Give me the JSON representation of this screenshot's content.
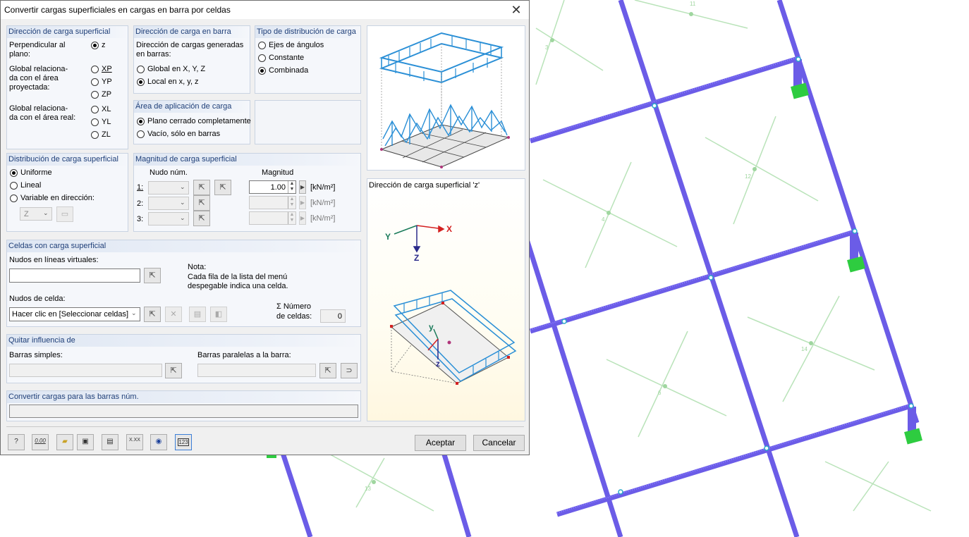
{
  "dialog": {
    "title": "Convertir cargas superficiales en cargas en barra por celdas",
    "close_icon": "close-icon"
  },
  "surface_load_direction": {
    "header": "Dirección de carga superficial",
    "perpendicular_label": "Perpendicular al plano:",
    "perpendicular_option": "z",
    "global_projected_label": "Global relaciona-da con el área proyectada:",
    "global_projected_options": [
      "XP",
      "YP",
      "ZP"
    ],
    "global_real_label": "Global relaciona-da con el área real:",
    "global_real_options": [
      "XL",
      "YL",
      "ZL"
    ],
    "selected": "z"
  },
  "member_load_direction": {
    "header": "Dirección de carga en barra",
    "description": "Dirección de cargas generadas en barras:",
    "options": [
      "Global en X, Y, Z",
      "Local en x, y, z"
    ],
    "selected": "Local en x, y, z"
  },
  "distribution_type": {
    "header": "Tipo de distribución de carga",
    "options": [
      "Ejes de ángulos",
      "Constante",
      "Combinada"
    ],
    "selected": "Combinada"
  },
  "load_application_area": {
    "header": "Área de aplicación de carga",
    "options": [
      "Plano cerrado completamente",
      "Vacío, sólo en barras"
    ],
    "selected": "Plano cerrado completamente"
  },
  "surface_load_distribution": {
    "header": "Distribución de carga superficial",
    "options": [
      "Uniforme",
      "Lineal",
      "Variable en dirección:"
    ],
    "selected": "Uniforme",
    "direction_value": "Z"
  },
  "surface_load_magnitude": {
    "header": "Magnitud de carga superficial",
    "node_col": "Nudo núm.",
    "magnitude_col": "Magnitud",
    "rows": [
      {
        "label": "1:",
        "value": "1.00",
        "unit": "[kN/m²]"
      },
      {
        "label": "2:",
        "value": "",
        "unit": "[kN/m²]"
      },
      {
        "label": "3:",
        "value": "",
        "unit": "[kN/m²]"
      }
    ]
  },
  "cells": {
    "header": "Celdas con carga superficial",
    "virtual_nodes_label": "Nudos en líneas virtuales:",
    "virtual_nodes_value": "",
    "note_title": "Nota:",
    "note_text_1": "Cada fila de la lista del menú",
    "note_text_2": "despegable indica una celda.",
    "cell_nodes_label": "Nudos de celda:",
    "cell_nodes_value": "Hacer clic en [Seleccionar celdas]",
    "count_label_1": "Σ Número",
    "count_label_2": "de celdas:",
    "count_value": "0"
  },
  "remove_influence": {
    "header": "Quitar influencia de",
    "simple_members_label": "Barras simples:",
    "parallel_members_label": "Barras paralelas a la barra:"
  },
  "convert_for_members": {
    "header": "Convertir cargas para las barras núm.",
    "value": ""
  },
  "info_panel": {
    "title": "Dirección de carga superficial 'z'",
    "axis_x": "X",
    "axis_y": "Y",
    "axis_z": "Z",
    "local_y": "y",
    "local_z": "z"
  },
  "footer": {
    "ok_label": "Aceptar",
    "cancel_label": "Cancelar",
    "tool_icons": [
      "help-icon",
      "decimal-places-icon",
      "open-icon",
      "save-icon",
      "view-icon",
      "units-icon",
      "eye-icon",
      "number-icon"
    ],
    "decimal_text": "0.00",
    "units_text": "X.XX",
    "number_text": "123"
  },
  "model": {
    "member_color": "#6b5ce7",
    "surface_line_color": "#9fd69f",
    "support_color": "#2ecc40",
    "surface_labels": [
      "11",
      "3",
      "12",
      "4",
      "14",
      "6",
      "13"
    ]
  }
}
